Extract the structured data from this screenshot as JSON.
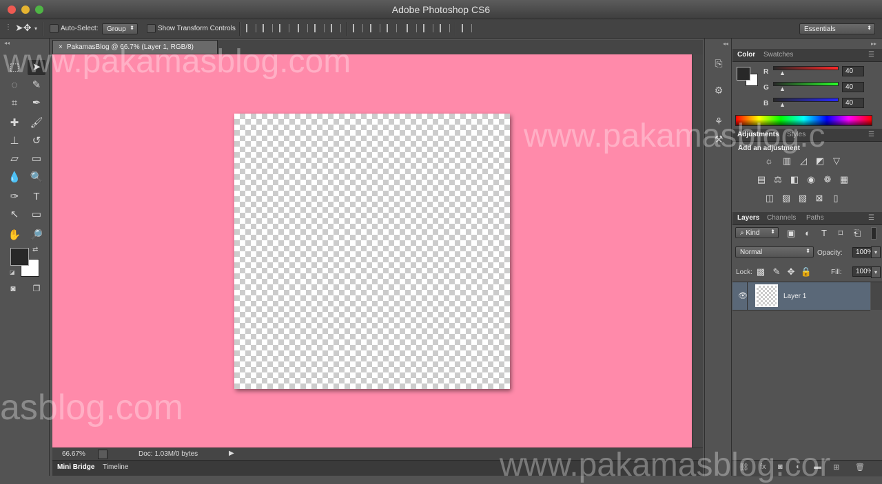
{
  "window": {
    "title": "Adobe Photoshop CS6"
  },
  "options_bar": {
    "auto_select_label": "Auto-Select:",
    "auto_select_value": "Group",
    "show_transform_label": "Show Transform Controls",
    "workspace": "Essentials"
  },
  "document": {
    "tab_title": "PakamasBlog @ 66.7% (Layer 1, RGB/8)",
    "zoom": "66.67%",
    "doc_size": "Doc: 1.03M/0 bytes"
  },
  "bottom_tabs": [
    "Mini Bridge",
    "Timeline"
  ],
  "color_panel": {
    "tabs": [
      "Color",
      "Swatches"
    ],
    "channels": [
      {
        "label": "R",
        "value": "40"
      },
      {
        "label": "G",
        "value": "40"
      },
      {
        "label": "B",
        "value": "40"
      }
    ],
    "foreground": "#282828",
    "background": "#ffffff"
  },
  "adjustments_panel": {
    "tabs": [
      "Adjustments",
      "Styles"
    ],
    "heading": "Add an adjustment"
  },
  "layers_panel": {
    "tabs": [
      "Layers",
      "Channels",
      "Paths"
    ],
    "filter_kind": "Kind",
    "blend_mode": "Normal",
    "opacity_label": "Opacity:",
    "opacity_value": "100%",
    "lock_label": "Lock:",
    "fill_label": "Fill:",
    "fill_value": "100%",
    "layers": [
      {
        "name": "Layer 1",
        "visible": true,
        "selected": true
      }
    ]
  },
  "watermark": {
    "texts": [
      "www.pakamasblog.com",
      "www.pakamasblog.c",
      "asblog.com",
      "www.pakamasblog.cor"
    ]
  },
  "colors": {
    "canvas_bg": "#ff8aaa",
    "ui_dark": "#535353",
    "selected_layer": "#5a6878"
  }
}
